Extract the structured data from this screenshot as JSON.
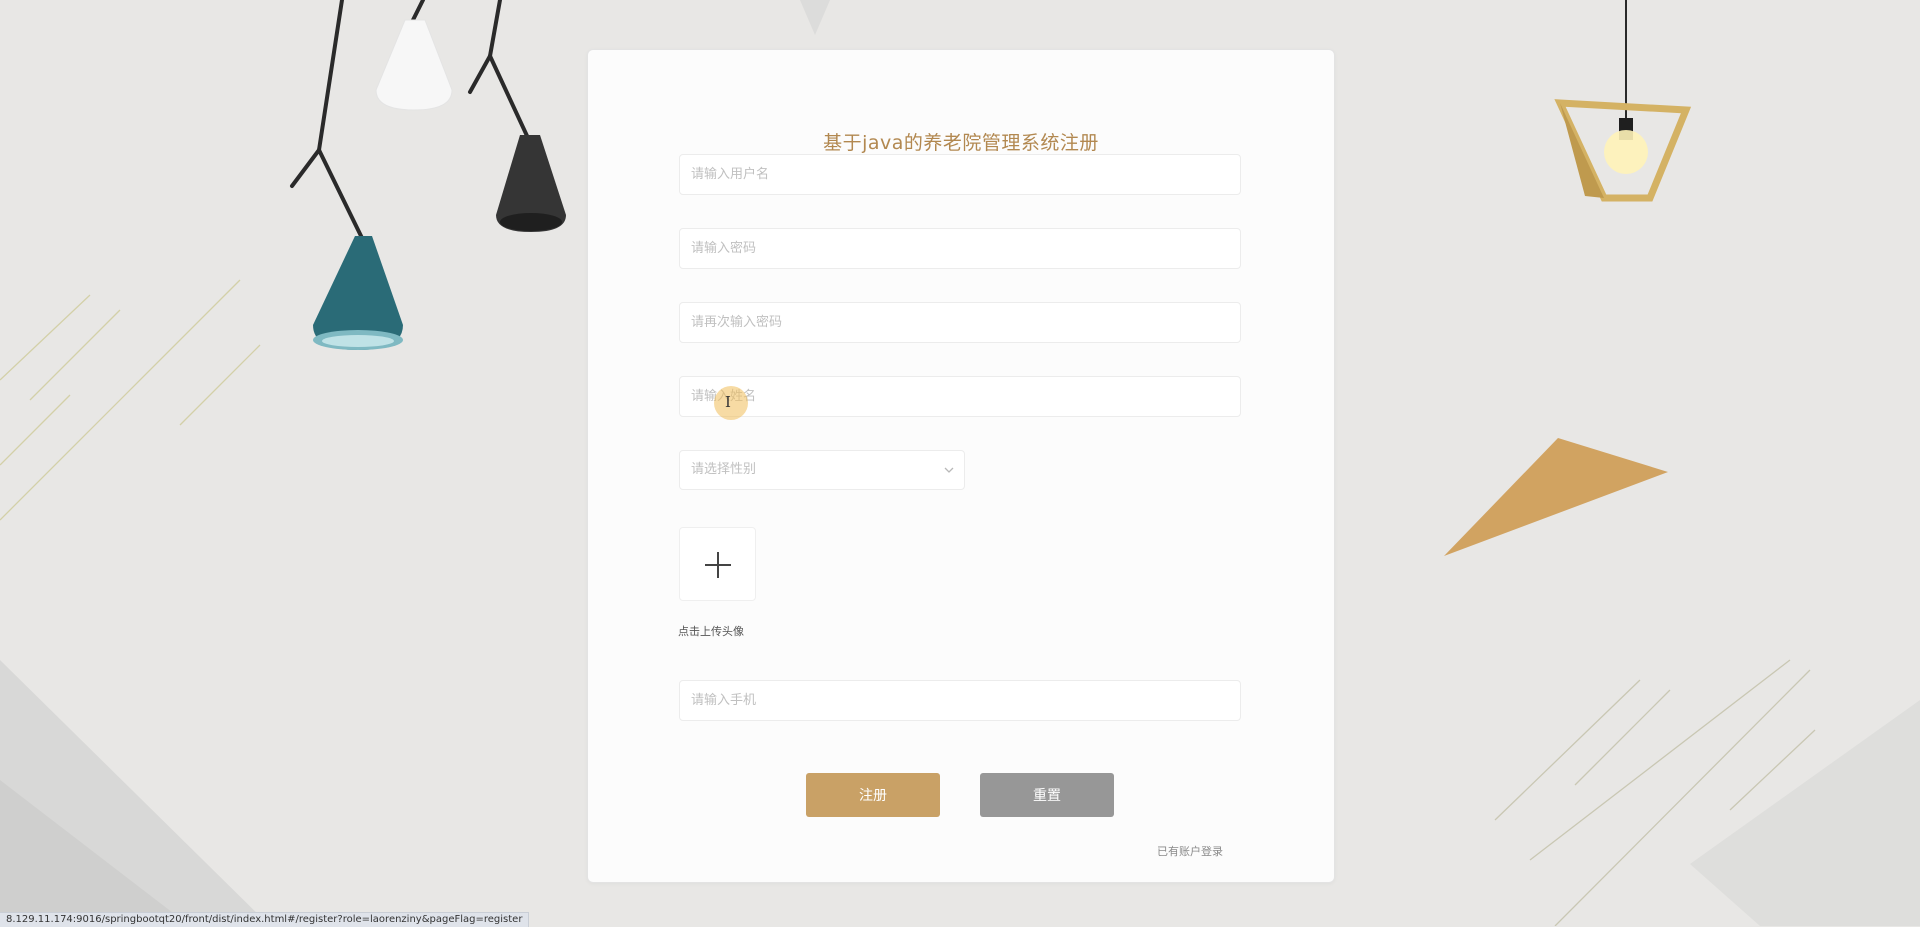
{
  "page": {
    "title": "基于java的养老院管理系统注册",
    "accent_color": "#c9a166",
    "title_color": "#b28850"
  },
  "form": {
    "username_placeholder": "请输入用户名",
    "password_placeholder": "请输入密码",
    "confirm_password_placeholder": "请再次输入密码",
    "name_placeholder": "请输入姓名",
    "gender_placeholder": "请选择性别",
    "avatar_upload_label": "点击上传头像",
    "phone_placeholder": "请输入手机"
  },
  "buttons": {
    "register_label": "注册",
    "reset_label": "重置"
  },
  "links": {
    "login_label": "已有账户登录"
  },
  "statusbar": {
    "url": "8.129.11.174:9016/springbootqt20/front/dist/index.html#/register?role=laorenziny&pageFlag=register"
  },
  "icons": {
    "upload": "plus-icon",
    "select": "chevron-down-icon"
  }
}
